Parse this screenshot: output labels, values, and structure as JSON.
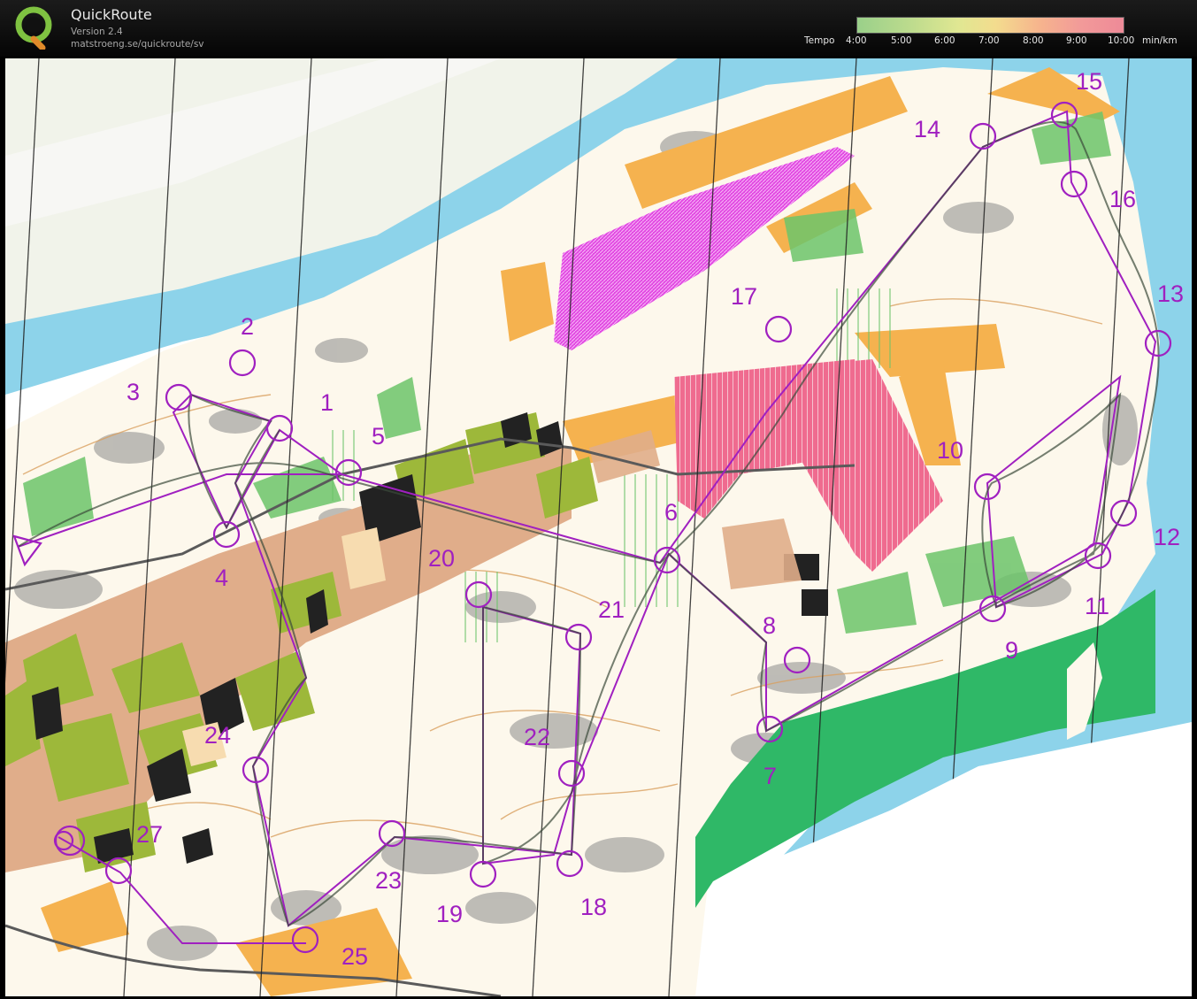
{
  "app": {
    "name": "QuickRoute",
    "version": "Version 2.4",
    "url": "matstroeng.se/quickroute/sv",
    "logo_letter": "Q"
  },
  "tempo": {
    "label": "Tempo",
    "ticks": [
      "4:00",
      "5:00",
      "6:00",
      "7:00",
      "8:00",
      "9:00",
      "10:00"
    ],
    "unit": "min/km",
    "colors": [
      "#9ad08a",
      "#e0e792",
      "#f6b58d",
      "#ee8a98"
    ]
  },
  "map": {
    "colors": {
      "water": "#8dd3ea",
      "forest": "#fdfaf2",
      "open": "#f5b24f",
      "green": "#6cc46a",
      "marsh_green": "#2fb867",
      "purple": "#a020c0",
      "magenta": "#e24ae2",
      "pink": "#ef6b8f",
      "buildings": "#222222",
      "olive": "#9db83a",
      "paved": "#e0ad8a"
    },
    "controls": [
      "1",
      "2",
      "3",
      "4",
      "5",
      "6",
      "7",
      "8",
      "9",
      "10",
      "11",
      "12",
      "13",
      "14",
      "15",
      "16",
      "17",
      "18",
      "19",
      "20",
      "21",
      "22",
      "23",
      "24",
      "25",
      "27"
    ]
  }
}
